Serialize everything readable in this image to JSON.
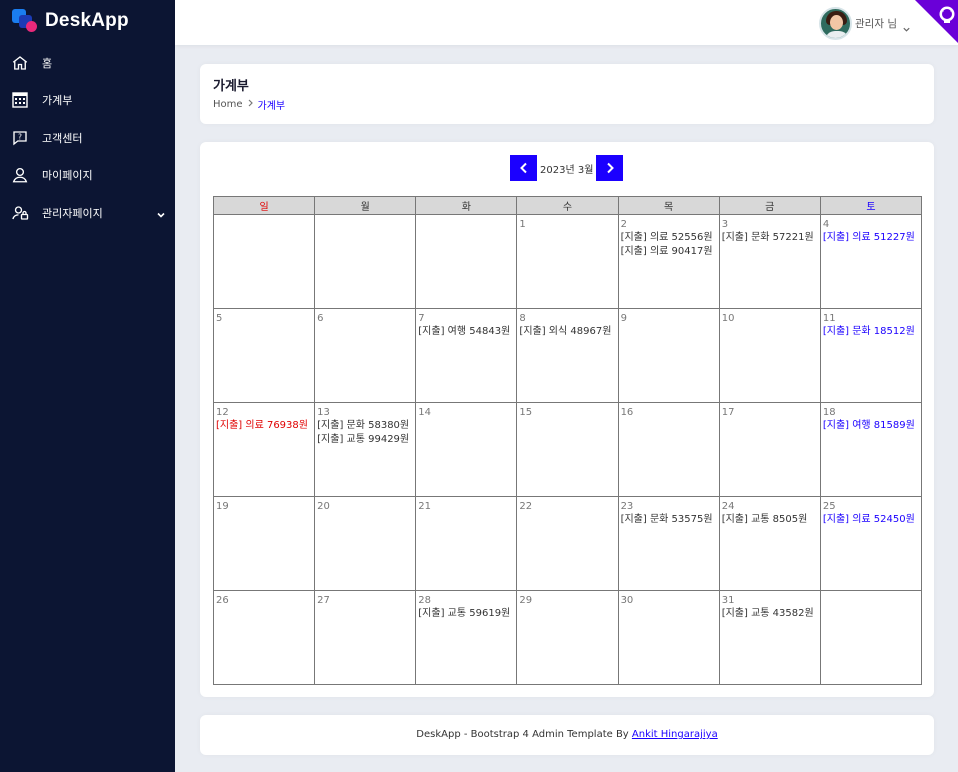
{
  "app": {
    "brand": "DeskApp"
  },
  "sidebar": {
    "items": [
      {
        "label": "홈",
        "icon": "home-icon"
      },
      {
        "label": "가계부",
        "icon": "calendar-grid-icon"
      },
      {
        "label": "고객센터",
        "icon": "help-chat-icon"
      },
      {
        "label": "마이페이지",
        "icon": "user-icon"
      },
      {
        "label": "관리자페이지",
        "icon": "admin-user-icon",
        "has_submenu": true
      }
    ]
  },
  "header": {
    "user_name": "관리자 님",
    "github_icon": "github-icon"
  },
  "page": {
    "title": "가계부",
    "breadcrumb_home": "Home",
    "breadcrumb_current": "가계부"
  },
  "calendar": {
    "month_label": "2023년 3월",
    "weekdays": [
      "일",
      "월",
      "화",
      "수",
      "목",
      "금",
      "토"
    ],
    "weeks": [
      [
        {
          "day": "",
          "events": []
        },
        {
          "day": "",
          "events": []
        },
        {
          "day": "",
          "events": []
        },
        {
          "day": "1",
          "events": []
        },
        {
          "day": "2",
          "events": [
            "[지출] 의료 52556원",
            "[지출] 의료 90417원"
          ]
        },
        {
          "day": "3",
          "events": [
            "[지출] 문화 57221원"
          ]
        },
        {
          "day": "4",
          "events": [
            "[지출] 의료 51227원"
          ]
        }
      ],
      [
        {
          "day": "5",
          "events": []
        },
        {
          "day": "6",
          "events": []
        },
        {
          "day": "7",
          "events": [
            "[지출] 여행 54843원"
          ]
        },
        {
          "day": "8",
          "events": [
            "[지출] 외식 48967원"
          ]
        },
        {
          "day": "9",
          "events": []
        },
        {
          "day": "10",
          "events": []
        },
        {
          "day": "11",
          "events": [
            "[지출] 문화 18512원"
          ]
        }
      ],
      [
        {
          "day": "12",
          "events": [
            "[지출] 의료 76938원"
          ]
        },
        {
          "day": "13",
          "events": [
            "[지출] 문화 58380원",
            "[지출] 교통 99429원"
          ]
        },
        {
          "day": "14",
          "events": []
        },
        {
          "day": "15",
          "events": []
        },
        {
          "day": "16",
          "events": []
        },
        {
          "day": "17",
          "events": []
        },
        {
          "day": "18",
          "events": [
            "[지출] 여행 81589원"
          ]
        }
      ],
      [
        {
          "day": "19",
          "events": []
        },
        {
          "day": "20",
          "events": []
        },
        {
          "day": "21",
          "events": []
        },
        {
          "day": "22",
          "events": []
        },
        {
          "day": "23",
          "events": [
            "[지출] 문화 53575원"
          ]
        },
        {
          "day": "24",
          "events": [
            "[지출] 교통 8505원"
          ]
        },
        {
          "day": "25",
          "events": [
            "[지출] 의료 52450원"
          ]
        }
      ],
      [
        {
          "day": "26",
          "events": []
        },
        {
          "day": "27",
          "events": []
        },
        {
          "day": "28",
          "events": [
            "[지출] 교통 59619원"
          ]
        },
        {
          "day": "29",
          "events": []
        },
        {
          "day": "30",
          "events": []
        },
        {
          "day": "31",
          "events": [
            "[지출] 교통 43582원"
          ]
        },
        {
          "day": "",
          "events": []
        }
      ]
    ]
  },
  "footer": {
    "text": "DeskApp - Bootstrap 4 Admin Template By ",
    "link": "Ankit Hingarajiya"
  },
  "colors": {
    "sidebar_bg": "#0c1533",
    "accent": "#1b00ff",
    "sunday": "#e00000",
    "saturday": "#1b00ff",
    "github_corner": "#6a00d8"
  }
}
